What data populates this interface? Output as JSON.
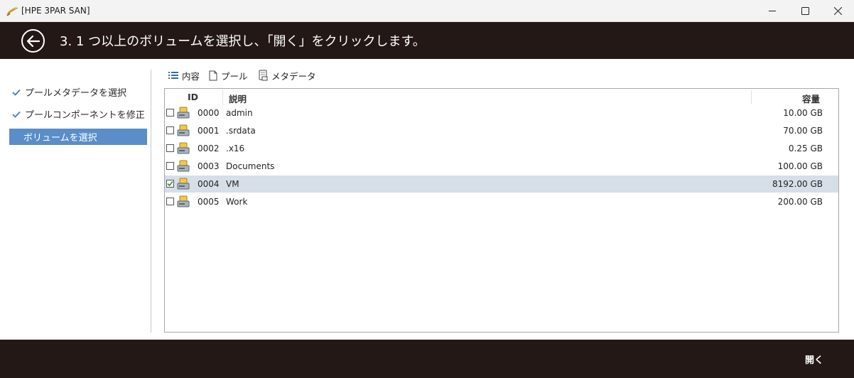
{
  "window": {
    "title": "[HPE 3PAR SAN]"
  },
  "header": {
    "title": "3. 1 つ以上のボリュームを選択し、「開く」をクリックします。"
  },
  "sidebar": {
    "steps": [
      {
        "label": "プールメタデータを選択",
        "done": true
      },
      {
        "label": "プールコンポーネントを修正",
        "done": true
      },
      {
        "label": "ボリュームを選択",
        "active": true
      }
    ]
  },
  "toolbar": {
    "contents": "内容",
    "pool": "プール",
    "metadata": "メタデータ"
  },
  "table": {
    "columns": {
      "id": "ID",
      "desc": "説明",
      "size": "容量"
    },
    "rows": [
      {
        "id": "0000",
        "desc": "admin",
        "size": "10.00 GB",
        "checked": false
      },
      {
        "id": "0001",
        "desc": ".srdata",
        "size": "70.00 GB",
        "checked": false
      },
      {
        "id": "0002",
        "desc": ".x16",
        "size": "0.25 GB",
        "checked": false
      },
      {
        "id": "0003",
        "desc": "Documents",
        "size": "100.00 GB",
        "checked": false
      },
      {
        "id": "0004",
        "desc": "VM",
        "size": "8192.00 GB",
        "checked": true
      },
      {
        "id": "0005",
        "desc": "Work",
        "size": "200.00 GB",
        "checked": false
      }
    ]
  },
  "footer": {
    "open_label": "開く"
  },
  "colors": {
    "header_bg": "#231816",
    "active_step": "#5a8ec8",
    "selected_row": "#d6dfe8",
    "check_green": "#2d8a3e"
  }
}
